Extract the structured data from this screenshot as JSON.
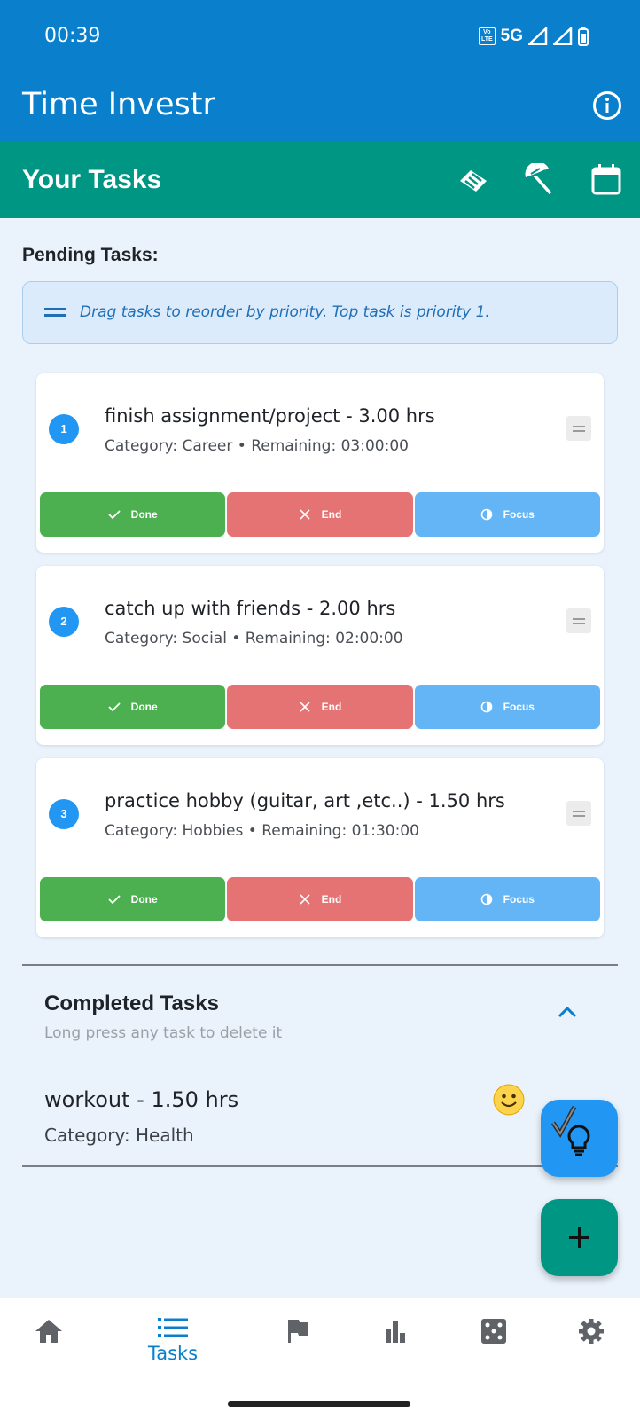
{
  "status_bar": {
    "time": "00:39",
    "network": "5G",
    "volte": "Vo LTE"
  },
  "app_bar": {
    "title": "Time Investr",
    "info_icon": "info-icon"
  },
  "task_bar": {
    "title": "Your Tasks",
    "icons": [
      "handshake-icon",
      "beach-umbrella-icon",
      "calendar-icon"
    ]
  },
  "pending": {
    "label": "Pending Tasks:",
    "hint": "Drag tasks to reorder by priority. Top task is priority 1.",
    "tasks": [
      {
        "num": "1",
        "title": "finish assignment/project - 3.00 hrs",
        "meta": "Category: Career • Remaining: 03:00:00"
      },
      {
        "num": "2",
        "title": "catch up with friends - 2.00 hrs",
        "meta": "Category: Social • Remaining: 02:00:00"
      },
      {
        "num": "3",
        "title": "practice hobby (guitar, art ,etc..) - 1.50 hrs",
        "meta": "Category: Hobbies • Remaining: 01:30:00"
      }
    ],
    "actions": {
      "done": "Done",
      "end": "End",
      "focus": "Focus"
    }
  },
  "completed": {
    "title": "Completed Tasks",
    "hint": "Long press any task to delete it",
    "items": [
      {
        "title": "workout - 1.50 hrs",
        "meta": "Category: Health",
        "emoji": "🙂"
      }
    ]
  },
  "bottom_nav": {
    "items": [
      {
        "icon": "home-icon",
        "label": ""
      },
      {
        "icon": "list-icon",
        "label": "Tasks"
      },
      {
        "icon": "flag-icon",
        "label": ""
      },
      {
        "icon": "bar-chart-icon",
        "label": ""
      },
      {
        "icon": "dice-icon",
        "label": ""
      },
      {
        "icon": "gear-icon",
        "label": ""
      }
    ],
    "active": "Tasks"
  },
  "colors": {
    "primary": "#0a7fcc",
    "teal": "#009684",
    "done": "#4caf50",
    "end": "#e57373",
    "focus": "#64b5f6",
    "badge": "#2196f3"
  }
}
